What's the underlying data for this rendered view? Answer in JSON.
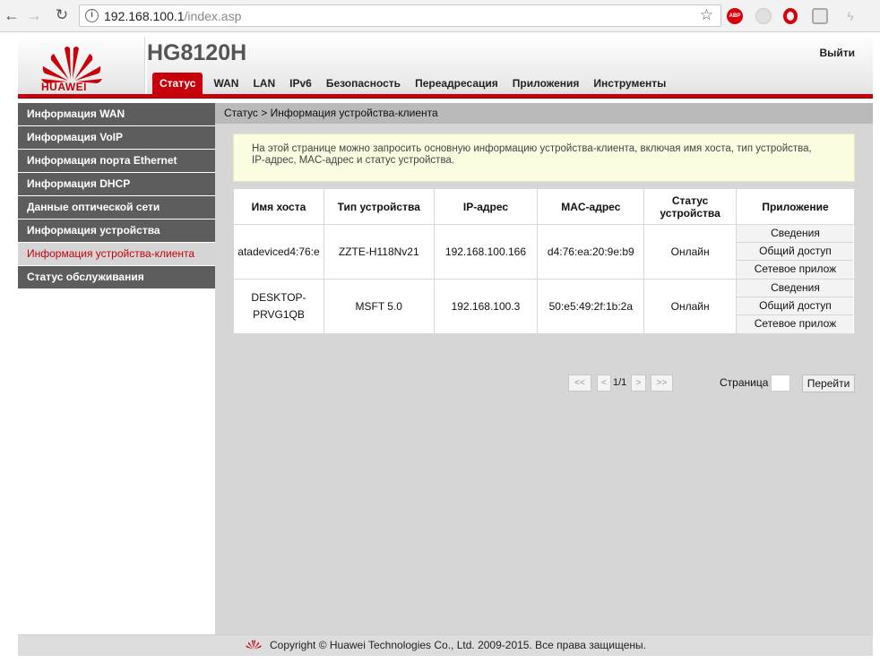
{
  "browser": {
    "url_host": "192.168.100.1",
    "url_path": "/index.asp",
    "abp_label": "ABP"
  },
  "header": {
    "brand": "HUAWEI",
    "model": "HG8120H",
    "logout": "Выйти",
    "brand_color": "#c7000b",
    "menu": [
      "Статус",
      "WAN",
      "LAN",
      "IPv6",
      "Безопасность",
      "Переадресация",
      "Приложения",
      "Инструменты"
    ]
  },
  "sidebar": {
    "items": [
      "Информация WAN",
      "Информация VoIP",
      "Информация порта Ethernet",
      "Информация DHCP",
      "Данные оптической сети",
      "Информация устройства",
      "Информация устройства-клиента",
      "Статус обслуживания"
    ],
    "active_index": 6
  },
  "content": {
    "breadcrumb": "Статус > Информация устройства-клиента",
    "notice_line1": "На этой странице можно запросить основную информацию устройства-клиента, включая имя хоста, тип устройства,",
    "notice_line2": "IP-адрес, MAC-адрес и статус устройства.",
    "table": {
      "headers": [
        "Имя хоста",
        "Тип устройства",
        "IP-адрес",
        "MAC-адрес",
        "Статус устройства",
        "Приложение"
      ],
      "header_status_line1": "Статус",
      "header_status_line2": "устройства",
      "rows": [
        {
          "host": "atadeviced4:76:e",
          "type": "ZZTE-H118Nv21",
          "ip": "192.168.100.166",
          "mac": "d4:76:ea:20:9e:b9",
          "status": "Онлайн"
        },
        {
          "host_line1": "DESKTOP-",
          "host_line2": "PRVG1QB",
          "type": "MSFT 5.0",
          "ip": "192.168.100.3",
          "mac": "50:e5:49:2f:1b:2a",
          "status": "Онлайн"
        }
      ],
      "app_buttons": [
        "Сведения",
        "Общий доступ",
        "Сетевое прилож"
      ]
    },
    "pager": {
      "first": "<<",
      "prev": "<",
      "current": "1/1",
      "next": ">",
      "last": ">>",
      "page_label": "Страница",
      "go": "Перейти"
    }
  },
  "footer": {
    "copyright": "Copyright © Huawei Technologies Co., Ltd. 2009-2015. Все права защищены."
  }
}
